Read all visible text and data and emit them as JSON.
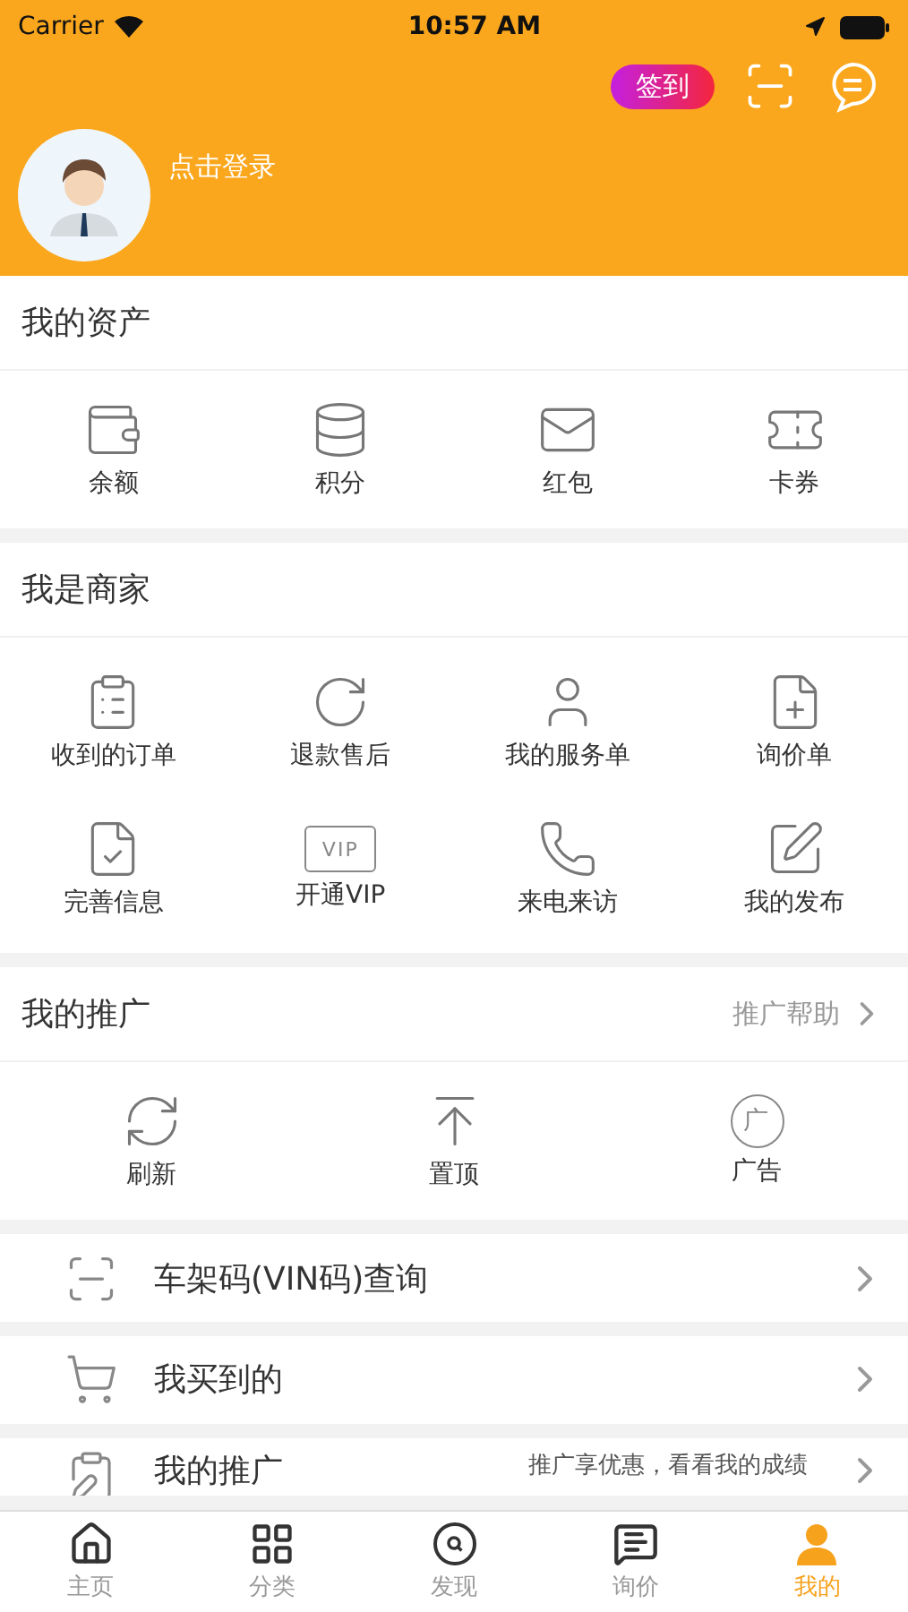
{
  "status_bar": {
    "carrier": "Carrier",
    "time": "10:57 AM"
  },
  "header": {
    "checkin_button": "签到",
    "login_prompt": "点击登录"
  },
  "sections": [
    {
      "title": "我的资产",
      "items": [
        {
          "label": "余额"
        },
        {
          "label": "积分"
        },
        {
          "label": "红包"
        },
        {
          "label": "卡券"
        }
      ]
    },
    {
      "title": "我是商家",
      "items": [
        {
          "label": "收到的订单"
        },
        {
          "label": "退款售后"
        },
        {
          "label": "我的服务单"
        },
        {
          "label": "询价单"
        },
        {
          "label": "完善信息"
        },
        {
          "label": "开通VIP",
          "icon_text": "VIP"
        },
        {
          "label": "来电来访"
        },
        {
          "label": "我的发布"
        }
      ]
    },
    {
      "title": "我的推广",
      "link": "推广帮助",
      "items": [
        {
          "label": "刷新"
        },
        {
          "label": "置顶"
        },
        {
          "label": "广告",
          "icon_text": "广"
        }
      ]
    }
  ],
  "list_rows": [
    {
      "label": "车架码(VIN码)查询"
    },
    {
      "label": "我买到的"
    },
    {
      "label": "我的推广",
      "note": "推广享优惠，看看我的成绩"
    }
  ],
  "tab_bar": [
    {
      "label": "主页",
      "selected": false
    },
    {
      "label": "分类",
      "selected": false
    },
    {
      "label": "发现",
      "selected": false
    },
    {
      "label": "询价",
      "selected": false
    },
    {
      "label": "我的",
      "selected": true
    }
  ]
}
